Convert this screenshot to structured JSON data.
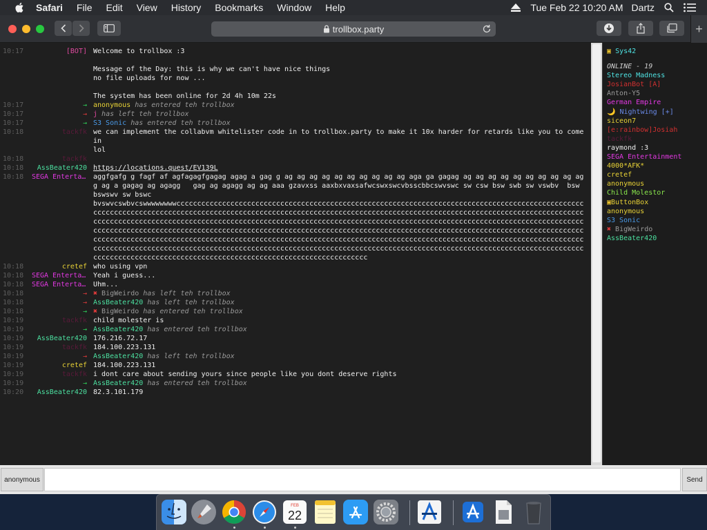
{
  "menubar": {
    "app": "Safari",
    "menus": [
      "File",
      "Edit",
      "View",
      "History",
      "Bookmarks",
      "Window",
      "Help"
    ],
    "datetime": "Tue Feb 22  10:20 AM",
    "user": "Dartz"
  },
  "browser": {
    "url": "trollbox.party"
  },
  "colors": {
    "green": "#4ce07a",
    "magenta": "#e238e2",
    "cyan": "#4fe3e3",
    "red_nick": "#d23030",
    "yellow_nick": "#e8d236",
    "blue_nick": "#4a7ad8",
    "white": "#f0f0f0",
    "gray": "#9a9a9a",
    "dark_red": "#7a2020"
  },
  "chat": {
    "messages": [
      {
        "ts": "10:17",
        "nick": "[BOT]",
        "nick_color": "#e04aa0",
        "text": "Welcome to trollbox :3"
      },
      {
        "ts": "",
        "nick": "",
        "nick_color": "",
        "text": " "
      },
      {
        "ts": "",
        "nick": "",
        "nick_color": "",
        "text": "Message of the Day: this is why we can't have nice things"
      },
      {
        "ts": "",
        "nick": "",
        "nick_color": "",
        "text": "no file uploads for now ..."
      },
      {
        "ts": "",
        "nick": "",
        "nick_color": "",
        "text": " "
      },
      {
        "ts": "",
        "nick": "",
        "nick_color": "",
        "text": "The system has been online for 2d 4h 10m 22s"
      },
      {
        "ts": "10:17",
        "event": "in",
        "user": "anonymous",
        "user_color": "#e8d236",
        "text": "has entered teh trollbox"
      },
      {
        "ts": "10:17",
        "event": "out",
        "user": "j",
        "user_color": "#e04aa0",
        "text": "has left teh trollbox"
      },
      {
        "ts": "10:17",
        "event": "in",
        "user": "S3 Sonic",
        "user_color": "#4a9ae8",
        "text": "has entered teh trollbox"
      },
      {
        "ts": "10:18",
        "nick": "tackfk",
        "nick_color": "#5a1a3a",
        "text": "we can implement the collabvm whitelister code in to trollbox.party to make it 10x harder for retards like you to come in"
      },
      {
        "ts": "",
        "nick": "",
        "nick_color": "",
        "text": "lol"
      },
      {
        "ts": "10:18",
        "nick": "tackfk",
        "nick_color": "#5a1a3a",
        "text": " "
      },
      {
        "ts": "10:18",
        "nick": "AssBeater420",
        "nick_color": "#4ce0a0",
        "link": "https://locations.quest/EV139L"
      },
      {
        "ts": "10:18",
        "nick": "SEGA Entertainment",
        "nick_color": "#e238e2",
        "text": "aggfgafg g fagf af agfagagfgagag agag a gag g ag ag ag ag ag ag ag ag ag ag aga ga gagag ag ag ag ag ag ag ag ag ag ag g ag a gagag ag agagg   gag ag agagg ag ag aaa gzavxss aaxbxvaxsafwcswxswcvbsscbbcswvswc sw csw bsw swb sw vswbv  bsw bswswv sw bswc"
      },
      {
        "ts": "",
        "nick": "",
        "nick_color": "",
        "text": "bvswvcswbvcswwwwwwwwcccccccccccccccccccccccccccccccccccccccccccccccccccccccccccccccccccccccccccccccccccccccccccccccccccccccccccccccccccccccccccccccccccccccccccccccccccccccccccccccccccccccccccccccccccccccccccccccccccccccccccccccccccccccccccccccccccccccccccccccccccccccccccccccccccccccccccccccccccccccccccccccccccccccccccccccccccccccccccccccccccccccccccccccccccccccccccccccccccccccccccccccccccccccccccccccccccccccccccccccccccccccccccccccccccccccccccccccccccccccccccccccccccccccccccccccccccccccccccccccccccccccccccccccccccccccccccccccccccccccccccccccccccccccccccccccccccccccccccccccccccccccccccccccccccccccccccccccccccccccccccccccccccccccccccccccccccccccccccccccccccccccccccccccccccccccccccccccccccccccccccccccccccccccccccccccccccccccccccccccccccccccccccccccccccccccccccccccccc"
      },
      {
        "ts": "10:18",
        "nick": "cretef",
        "nick_color": "#e8d236",
        "text": "who using vpn"
      },
      {
        "ts": "10:18",
        "nick": "SEGA Entertainment",
        "nick_color": "#e238e2",
        "text": "Yeah i guess..."
      },
      {
        "ts": "10:18",
        "nick": "SEGA Entertainment",
        "nick_color": "#e238e2",
        "text": "Uhm..."
      },
      {
        "ts": "10:18",
        "event": "out",
        "user": "BigWeirdo",
        "user_color": "#9a9a9a",
        "x": true,
        "text": "has left teh trollbox"
      },
      {
        "ts": "10:18",
        "event": "out",
        "user": "AssBeater420",
        "user_color": "#4ce0a0",
        "text": "has left teh trollbox"
      },
      {
        "ts": "10:18",
        "event": "in",
        "user": "BigWeirdo",
        "user_color": "#9a9a9a",
        "x": true,
        "text": "has entered teh trollbox"
      },
      {
        "ts": "10:19",
        "nick": "tackfk",
        "nick_color": "#5a1a3a",
        "text": "child molester is"
      },
      {
        "ts": "10:19",
        "event": "in",
        "user": "AssBeater420",
        "user_color": "#4ce0a0",
        "text": "has entered teh trollbox"
      },
      {
        "ts": "10:19",
        "nick": "AssBeater420",
        "nick_color": "#4ce0a0",
        "text": "176.216.72.17"
      },
      {
        "ts": "10:19",
        "nick": "tackfk",
        "nick_color": "#5a1a3a",
        "text": "184.100.223.131"
      },
      {
        "ts": "10:19",
        "event": "out",
        "user": "AssBeater420",
        "user_color": "#4ce0a0",
        "text": "has left teh trollbox"
      },
      {
        "ts": "10:19",
        "nick": "cretef",
        "nick_color": "#e8d236",
        "text": "184.100.223.131"
      },
      {
        "ts": "10:19",
        "nick": "tackfk",
        "nick_color": "#5a1a3a",
        "text": "i dont care about sending yours since people like you dont deserve rights"
      },
      {
        "ts": "10:19",
        "event": "in",
        "user": "AssBeater420",
        "user_color": "#4ce0a0",
        "text": "has entered teh trollbox"
      },
      {
        "ts": "10:20",
        "nick": "AssBeater420",
        "nick_color": "#4ce0a0",
        "text": "82.3.101.179"
      }
    ]
  },
  "users": {
    "self": "Sys42",
    "online_label": "ONLINE - 19",
    "list": [
      {
        "name": "Stereo Madness",
        "color": "#4fe3e3"
      },
      {
        "name": "JosianBot [A]",
        "color": "#d23030"
      },
      {
        "name": "Anton-Y5",
        "color": "#9a9a9a"
      },
      {
        "name": "German Empire",
        "color": "#e238e2"
      },
      {
        "name": "🌙 Nightwing [+]",
        "color": "#6a8ae8"
      },
      {
        "name": "siceon7",
        "color": "#e8d236"
      },
      {
        "name": "[e:rainbow]Josiah",
        "color": "#d23030"
      },
      {
        "name": "tackfk",
        "color": "#5a1a3a"
      },
      {
        "name": "raymond :3",
        "color": "#f0f0f0"
      },
      {
        "name": "SEGA Entertainment",
        "color": "#e238e2"
      },
      {
        "name": "4000*AFK*",
        "color": "#e8d236"
      },
      {
        "name": "cretef",
        "color": "#e8d236"
      },
      {
        "name": "anonymous",
        "color": "#e8d236"
      },
      {
        "name": "Child Molestor",
        "color": "#8ae84c"
      },
      {
        "name": "ButtonBox",
        "color": "#e8d236",
        "icon": true
      },
      {
        "name": "anonymous",
        "color": "#e8d236"
      },
      {
        "name": "S3 Sonic",
        "color": "#4a9ae8"
      },
      {
        "name": "BigWeirdo",
        "color": "#9a9a9a",
        "x": true
      },
      {
        "name": "AssBeater420",
        "color": "#4ce0a0"
      }
    ]
  },
  "input": {
    "nick": "anonymous",
    "value": "",
    "send": "Send"
  },
  "dock": {
    "apps": [
      "Finder",
      "Launchpad",
      "Google Chrome",
      "Safari",
      "Calendar",
      "Notes",
      "App Store",
      "System Preferences",
      "Xcode Instruments",
      "Xcode",
      "Preview",
      "Trash"
    ],
    "calendar_month": "FEB",
    "calendar_day": "22"
  }
}
